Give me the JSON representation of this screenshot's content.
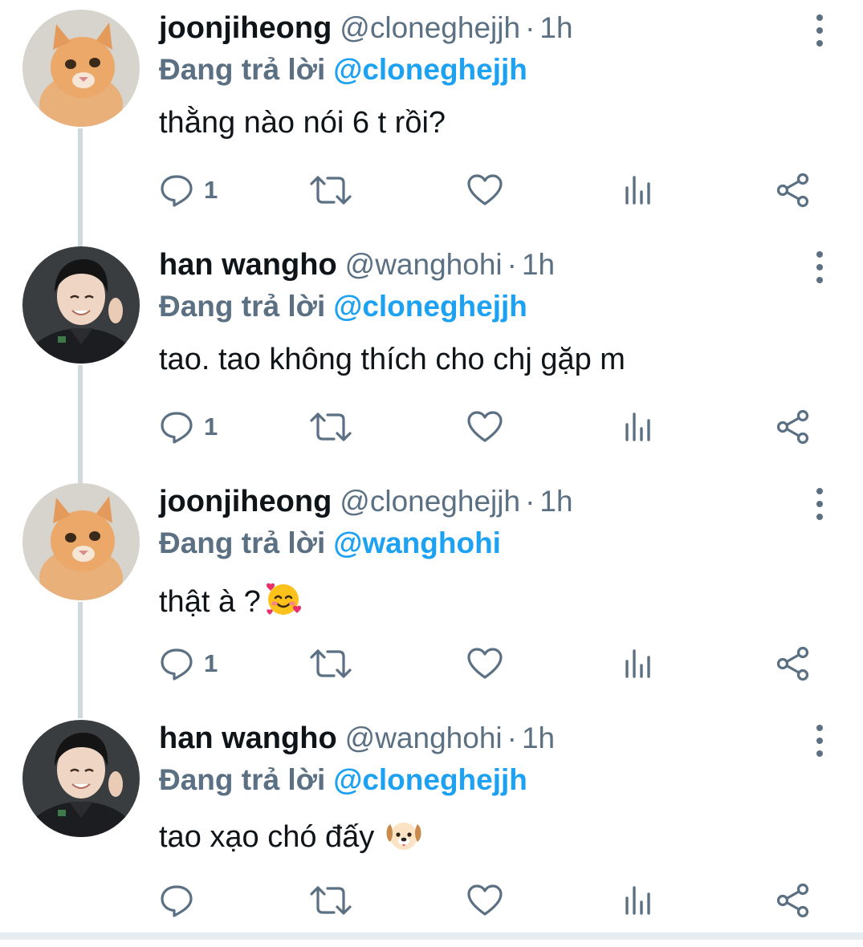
{
  "app": {
    "reply_prefix": "Đang trả lời",
    "dot": "·"
  },
  "colors": {
    "accent": "#1da1f2",
    "secondary_text": "#5b7083",
    "thread_line": "#cfd9de"
  },
  "tweets": [
    {
      "name": "joonjiheong",
      "handle": "@cloneghejjh",
      "time": "1h",
      "reply_to": "@cloneghejjh",
      "text": "thằng nào nói 6 t rồi?",
      "emoji": "",
      "reply_count": "1",
      "avatar": "cat-avatar"
    },
    {
      "name": "han wangho",
      "handle": "@wanghohi",
      "time": "1h",
      "reply_to": "@cloneghejjh",
      "text": "tao. tao không thích cho chj gặp m",
      "emoji": "",
      "reply_count": "1",
      "avatar": "person-avatar"
    },
    {
      "name": "joonjiheong",
      "handle": "@cloneghejjh",
      "time": "1h",
      "reply_to": "@wanghohi",
      "text": "thật à ?",
      "emoji": "smiling-face-with-hearts-emoji",
      "reply_count": "1",
      "avatar": "cat-avatar"
    },
    {
      "name": "han wangho",
      "handle": "@wanghohi",
      "time": "1h",
      "reply_to": "@cloneghejjh",
      "text": "tao xạo chó đấy",
      "emoji": "dog-face-emoji",
      "reply_count": "",
      "avatar": "person-avatar"
    }
  ]
}
